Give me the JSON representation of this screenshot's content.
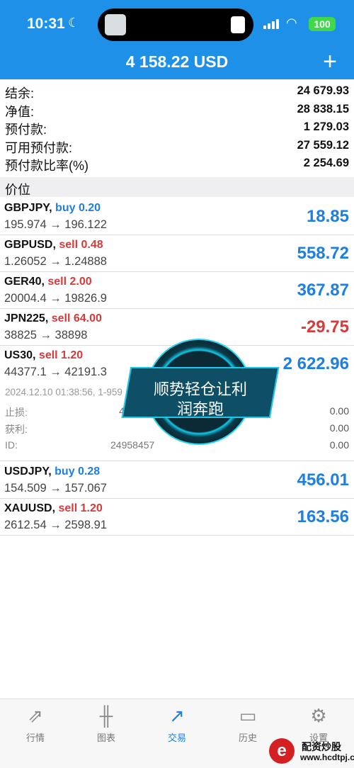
{
  "status": {
    "time": "10:31",
    "battery": "100"
  },
  "header": {
    "title": "4 158.22 USD",
    "add_label": "+"
  },
  "summary": [
    {
      "label": "结余:",
      "value": "24 679.93"
    },
    {
      "label": "净值:",
      "value": "28 838.15"
    },
    {
      "label": "预付款:",
      "value": "1 279.03"
    },
    {
      "label": "可用预付款:",
      "value": "27 559.12"
    },
    {
      "label": "预付款比率(%)",
      "value": "2 254.69"
    }
  ],
  "section_label": "价位",
  "positions": [
    {
      "symbol": "GBPJPY,",
      "side": "buy 0.20",
      "prices": "195.974 → 196.122",
      "pnl": "18.85"
    },
    {
      "symbol": "GBPUSD,",
      "side": "sell 0.48",
      "prices": "1.26052 → 1.24888",
      "pnl": "558.72"
    },
    {
      "symbol": "GER40,",
      "side": "sell 2.00",
      "prices": "20004.4 → 19826.9",
      "pnl": "367.87"
    },
    {
      "symbol": "JPN225,",
      "side": "sell 64.00",
      "prices": "38825 → 38898",
      "pnl": "-29.75"
    },
    {
      "symbol": "US30,",
      "side": "sell 1.20",
      "prices": "44377.1 → 42191.3",
      "pnl": "2 622.96"
    },
    {
      "symbol": "USDJPY,",
      "side": "buy 0.28",
      "prices": "154.509 → 157.067",
      "pnl": "456.01"
    },
    {
      "symbol": "XAUUSD,",
      "side": "sell 1.20",
      "prices": "2612.54 → 2598.91",
      "pnl": "163.56"
    }
  ],
  "detail": {
    "meta": "2024.12.10 01:38:56, 1-959",
    "stop_loss_label": "止损:",
    "stop_loss_value": "443",
    "take_profit_label": "获利:",
    "id_label": "ID:",
    "id_value": "24958457",
    "right_1": "0.00",
    "right_2": "0.00",
    "right_3": "0.00"
  },
  "promo": {
    "line1": "顺势轻仓让利",
    "line2": "润奔跑"
  },
  "tabs": [
    {
      "label": "行情",
      "icon": "quotes-icon"
    },
    {
      "label": "图表",
      "icon": "chart-icon"
    },
    {
      "label": "交易",
      "icon": "trade-icon",
      "active": true
    },
    {
      "label": "历史",
      "icon": "history-icon"
    },
    {
      "label": "设置",
      "icon": "settings-icon"
    }
  ],
  "watermark": {
    "name": "配资炒股",
    "url": "www.hcdtpj.com"
  },
  "colors": {
    "accent": "#1e90e8",
    "buy": "#1e7fe0",
    "sell": "#d63a3a"
  }
}
